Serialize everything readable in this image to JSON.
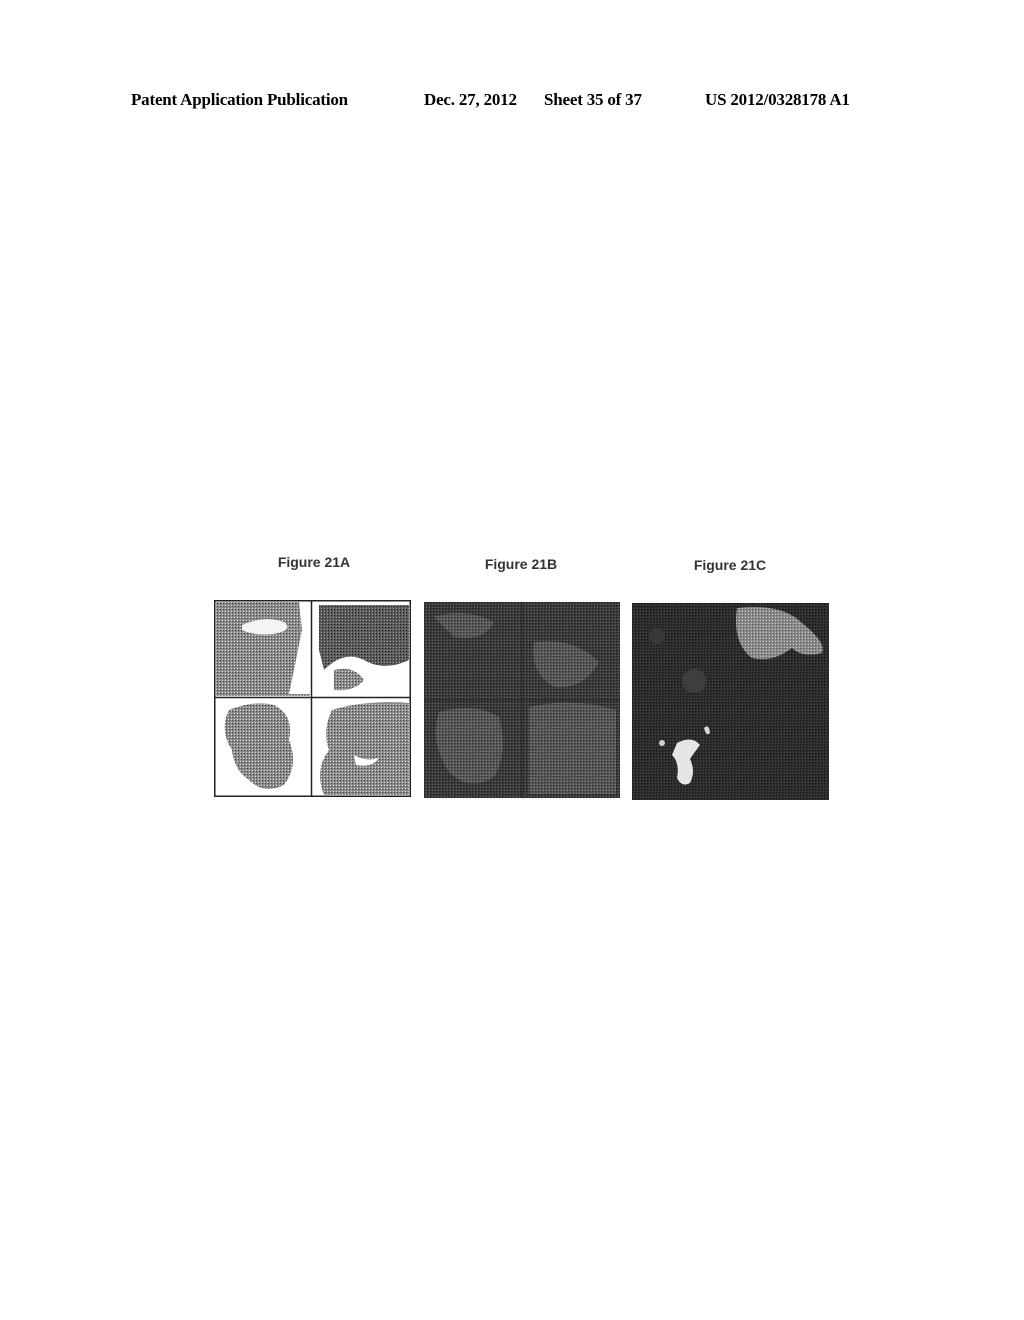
{
  "header": {
    "publication_type": "Patent Application Publication",
    "date": "Dec. 27, 2012",
    "sheet": "Sheet 35 of 37",
    "patent_number": "US 2012/0328178 A1"
  },
  "figures": [
    {
      "label": "Figure 21A",
      "description": "Grayscale tissue section micrograph composed of four quadrants"
    },
    {
      "label": "Figure 21B",
      "description": "Dark fluorescence image of tissue sections in four quadrants"
    },
    {
      "label": "Figure 21C",
      "description": "Dark fluorescence image with bright staining in upper right and lower left regions"
    }
  ]
}
